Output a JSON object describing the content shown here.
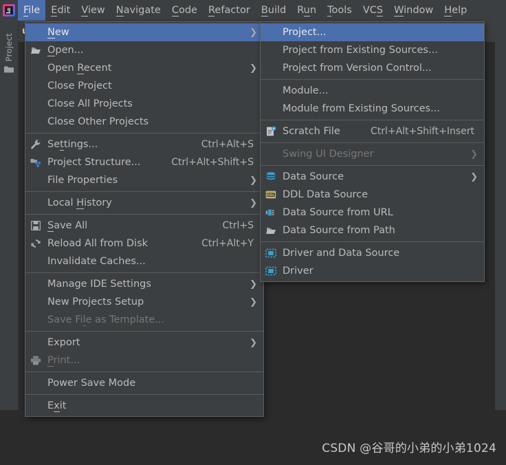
{
  "window": {
    "logo_icon": "intellij-idea-logo-icon",
    "background_color": "#2b2b2b",
    "chrome_color": "#3c3f41",
    "accent_color": "#4b6eac",
    "text_color": "#bbbbbb"
  },
  "menubar": {
    "items": [
      {
        "label": "File",
        "mnemonic": "F",
        "active": true
      },
      {
        "label": "Edit",
        "mnemonic": "E",
        "active": false
      },
      {
        "label": "View",
        "mnemonic": "V",
        "active": false
      },
      {
        "label": "Navigate",
        "mnemonic": "N",
        "active": false
      },
      {
        "label": "Code",
        "mnemonic": "C",
        "active": false
      },
      {
        "label": "Refactor",
        "mnemonic": "R",
        "active": false
      },
      {
        "label": "Build",
        "mnemonic": "B",
        "active": false
      },
      {
        "label": "Run",
        "mnemonic": "u",
        "active": false
      },
      {
        "label": "Tools",
        "mnemonic": "T",
        "active": false
      },
      {
        "label": "VCS",
        "mnemonic": "S",
        "active": false
      },
      {
        "label": "Window",
        "mnemonic": "W",
        "active": false
      },
      {
        "label": "Help",
        "mnemonic": "H",
        "active": false
      }
    ]
  },
  "sidebar": {
    "tool_label": "Project",
    "folder_icon": "folder-icon"
  },
  "editor": {
    "tab_label": "use"
  },
  "file_menu": {
    "items": [
      {
        "type": "item",
        "label": "New",
        "mnemonic": "N",
        "icon": null,
        "accel": null,
        "submenu": true,
        "selected": true,
        "disabled": false
      },
      {
        "type": "item",
        "label": "Open...",
        "mnemonic": "O",
        "icon": "open-folder-icon",
        "accel": null,
        "submenu": false,
        "selected": false,
        "disabled": false
      },
      {
        "type": "item",
        "label": "Open Recent",
        "mnemonic": "R",
        "icon": null,
        "accel": null,
        "submenu": true,
        "selected": false,
        "disabled": false
      },
      {
        "type": "item",
        "label": "Close Project",
        "mnemonic": null,
        "icon": null,
        "accel": null,
        "submenu": false,
        "selected": false,
        "disabled": false
      },
      {
        "type": "item",
        "label": "Close All Projects",
        "mnemonic": null,
        "icon": null,
        "accel": null,
        "submenu": false,
        "selected": false,
        "disabled": false
      },
      {
        "type": "item",
        "label": "Close Other Projects",
        "mnemonic": null,
        "icon": null,
        "accel": null,
        "submenu": false,
        "selected": false,
        "disabled": false
      },
      {
        "type": "separator"
      },
      {
        "type": "item",
        "label": "Settings...",
        "mnemonic": "t",
        "icon": "wrench-icon",
        "accel": "Ctrl+Alt+S",
        "submenu": false,
        "selected": false,
        "disabled": false
      },
      {
        "type": "item",
        "label": "Project Structure...",
        "mnemonic": null,
        "icon": "project-structure-icon",
        "accel": "Ctrl+Alt+Shift+S",
        "submenu": false,
        "selected": false,
        "disabled": false
      },
      {
        "type": "item",
        "label": "File Properties",
        "mnemonic": null,
        "icon": null,
        "accel": null,
        "submenu": true,
        "selected": false,
        "disabled": false
      },
      {
        "type": "separator"
      },
      {
        "type": "item",
        "label": "Local History",
        "mnemonic": "H",
        "icon": null,
        "accel": null,
        "submenu": true,
        "selected": false,
        "disabled": false
      },
      {
        "type": "separator"
      },
      {
        "type": "item",
        "label": "Save All",
        "mnemonic": "S",
        "icon": "save-icon",
        "accel": "Ctrl+S",
        "submenu": false,
        "selected": false,
        "disabled": false
      },
      {
        "type": "item",
        "label": "Reload All from Disk",
        "mnemonic": null,
        "icon": "reload-icon",
        "accel": "Ctrl+Alt+Y",
        "submenu": false,
        "selected": false,
        "disabled": false
      },
      {
        "type": "item",
        "label": "Invalidate Caches...",
        "mnemonic": null,
        "icon": null,
        "accel": null,
        "submenu": false,
        "selected": false,
        "disabled": false
      },
      {
        "type": "separator"
      },
      {
        "type": "item",
        "label": "Manage IDE Settings",
        "mnemonic": null,
        "icon": null,
        "accel": null,
        "submenu": true,
        "selected": false,
        "disabled": false
      },
      {
        "type": "item",
        "label": "New Projects Setup",
        "mnemonic": null,
        "icon": null,
        "accel": null,
        "submenu": true,
        "selected": false,
        "disabled": false
      },
      {
        "type": "item",
        "label": "Save File as Template...",
        "mnemonic": "l",
        "icon": null,
        "accel": null,
        "submenu": false,
        "selected": false,
        "disabled": true
      },
      {
        "type": "separator"
      },
      {
        "type": "item",
        "label": "Export",
        "mnemonic": null,
        "icon": null,
        "accel": null,
        "submenu": true,
        "selected": false,
        "disabled": false
      },
      {
        "type": "item",
        "label": "Print...",
        "mnemonic": "P",
        "icon": "printer-icon",
        "accel": null,
        "submenu": false,
        "selected": false,
        "disabled": true
      },
      {
        "type": "separator"
      },
      {
        "type": "item",
        "label": "Power Save Mode",
        "mnemonic": null,
        "icon": null,
        "accel": null,
        "submenu": false,
        "selected": false,
        "disabled": false
      },
      {
        "type": "separator"
      },
      {
        "type": "item",
        "label": "Exit",
        "mnemonic": "x",
        "icon": null,
        "accel": null,
        "submenu": false,
        "selected": false,
        "disabled": false
      }
    ]
  },
  "new_submenu": {
    "items": [
      {
        "type": "item",
        "label": "Project...",
        "mnemonic": null,
        "icon": null,
        "accel": null,
        "submenu": false,
        "selected": true,
        "disabled": false
      },
      {
        "type": "item",
        "label": "Project from Existing Sources...",
        "mnemonic": null,
        "icon": null,
        "accel": null,
        "submenu": false,
        "selected": false,
        "disabled": false
      },
      {
        "type": "item",
        "label": "Project from Version Control...",
        "mnemonic": null,
        "icon": null,
        "accel": null,
        "submenu": false,
        "selected": false,
        "disabled": false
      },
      {
        "type": "separator"
      },
      {
        "type": "item",
        "label": "Module...",
        "mnemonic": null,
        "icon": null,
        "accel": null,
        "submenu": false,
        "selected": false,
        "disabled": false
      },
      {
        "type": "item",
        "label": "Module from Existing Sources...",
        "mnemonic": null,
        "icon": null,
        "accel": null,
        "submenu": false,
        "selected": false,
        "disabled": false
      },
      {
        "type": "separator"
      },
      {
        "type": "item",
        "label": "Scratch File",
        "mnemonic": null,
        "icon": "scratch-file-icon",
        "accel": "Ctrl+Alt+Shift+Insert",
        "submenu": false,
        "selected": false,
        "disabled": false
      },
      {
        "type": "separator"
      },
      {
        "type": "item",
        "label": "Swing UI Designer",
        "mnemonic": null,
        "icon": null,
        "accel": null,
        "submenu": true,
        "selected": false,
        "disabled": true
      },
      {
        "type": "separator"
      },
      {
        "type": "item",
        "label": "Data Source",
        "mnemonic": null,
        "icon": "database-icon",
        "accel": null,
        "submenu": true,
        "selected": false,
        "disabled": false
      },
      {
        "type": "item",
        "label": "DDL Data Source",
        "mnemonic": null,
        "icon": "ddl-icon",
        "accel": null,
        "submenu": false,
        "selected": false,
        "disabled": false
      },
      {
        "type": "item",
        "label": "Data Source from URL",
        "mnemonic": null,
        "icon": "plug-icon",
        "accel": null,
        "submenu": false,
        "selected": false,
        "disabled": false
      },
      {
        "type": "item",
        "label": "Data Source from Path",
        "mnemonic": null,
        "icon": "open-folder-icon",
        "accel": null,
        "submenu": false,
        "selected": false,
        "disabled": false
      },
      {
        "type": "separator"
      },
      {
        "type": "item",
        "label": "Driver and Data Source",
        "mnemonic": null,
        "icon": "driver-icon",
        "accel": null,
        "submenu": false,
        "selected": false,
        "disabled": false
      },
      {
        "type": "item",
        "label": "Driver",
        "mnemonic": null,
        "icon": "driver-icon",
        "accel": null,
        "submenu": false,
        "selected": false,
        "disabled": false
      }
    ]
  },
  "watermark": {
    "text": "CSDN @谷哥的小弟的小弟1024"
  }
}
